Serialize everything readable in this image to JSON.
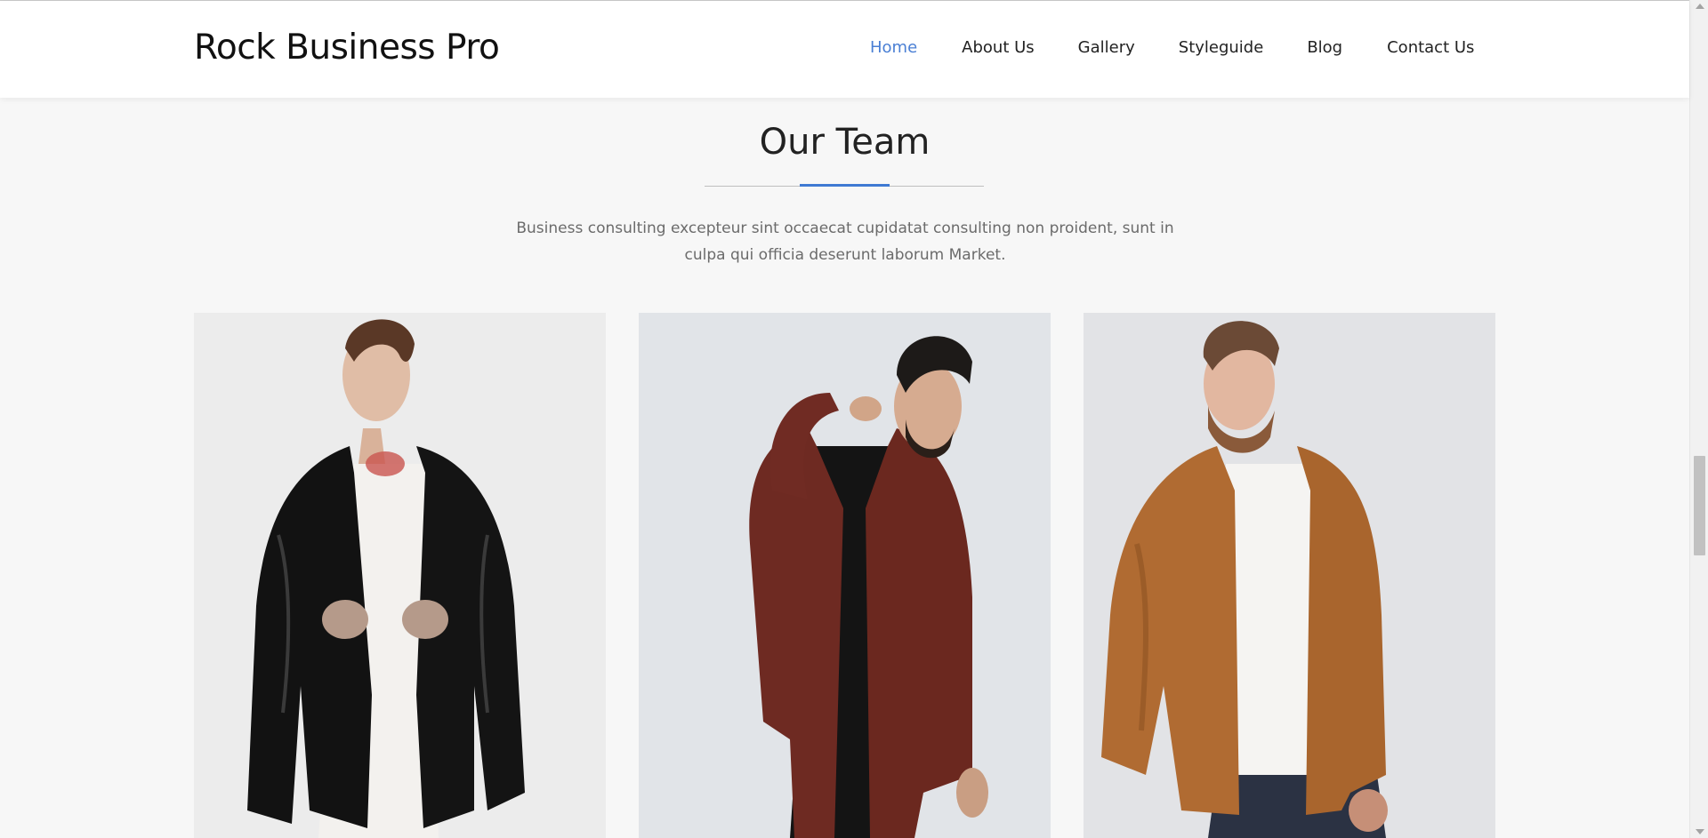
{
  "header": {
    "site_title": "Rock Business Pro",
    "nav": [
      {
        "label": "Home",
        "active": true
      },
      {
        "label": "About Us",
        "active": false
      },
      {
        "label": "Gallery",
        "active": false
      },
      {
        "label": "Styleguide",
        "active": false
      },
      {
        "label": "Blog",
        "active": false
      },
      {
        "label": "Contact Us",
        "active": false
      }
    ]
  },
  "team_section": {
    "title": "Our Team",
    "description": "Business consulting excepteur sint occaecat cupidatat consulting non proident, sunt in culpa qui officia deserunt laborum Market.",
    "members": [
      {
        "photo": "team-member-photo",
        "jacket_color": "#121212"
      },
      {
        "photo": "team-member-photo",
        "jacket_color": "#6e2a22"
      },
      {
        "photo": "team-member-photo",
        "jacket_color": "#b06b32"
      }
    ]
  },
  "colors": {
    "accent": "#3f7ad3",
    "nav_active": "#4a7fd4",
    "page_bg": "#f7f7f7"
  }
}
